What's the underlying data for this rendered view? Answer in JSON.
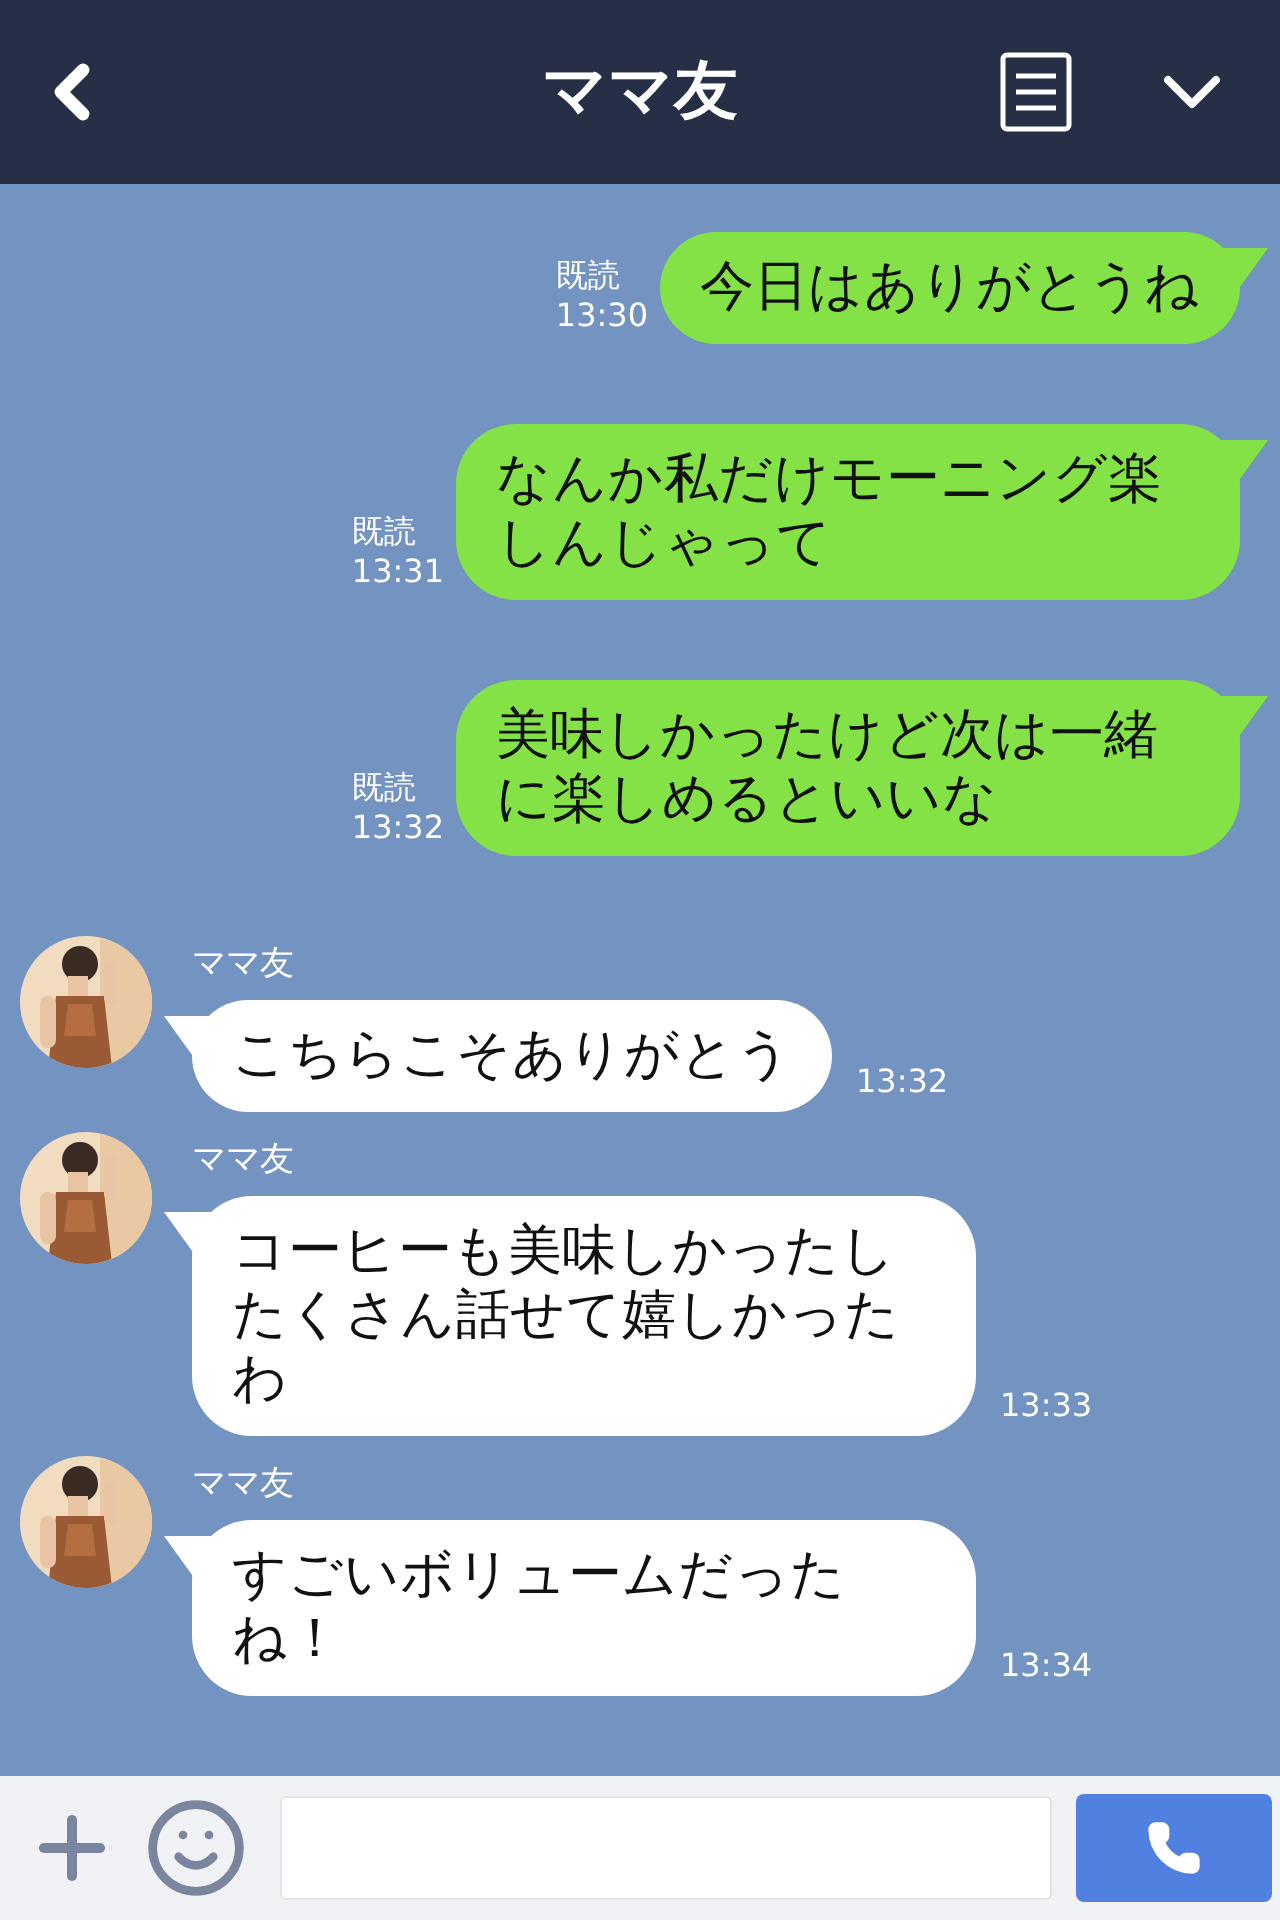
{
  "header": {
    "title": "ママ友"
  },
  "messages": [
    {
      "kind": "sent",
      "text": "今日はありがとうね",
      "read": "既読",
      "time": "13:30"
    },
    {
      "kind": "sent",
      "text": "なんか私だけモーニング楽しんじゃって",
      "read": "既読",
      "time": "13:31"
    },
    {
      "kind": "sent",
      "text": "美味しかったけど次は一緒に楽しめるといいな",
      "read": "既読",
      "time": "13:32"
    },
    {
      "kind": "received",
      "name": "ママ友",
      "text": "こちらこそありがとう",
      "time": "13:32"
    },
    {
      "kind": "received",
      "name": "ママ友",
      "text": "コーヒーも美味しかったしたくさん話せて嬉しかったわ",
      "time": "13:33"
    },
    {
      "kind": "received",
      "name": "ママ友",
      "text": "すごいボリュームだったね！",
      "time": "13:34"
    }
  ]
}
